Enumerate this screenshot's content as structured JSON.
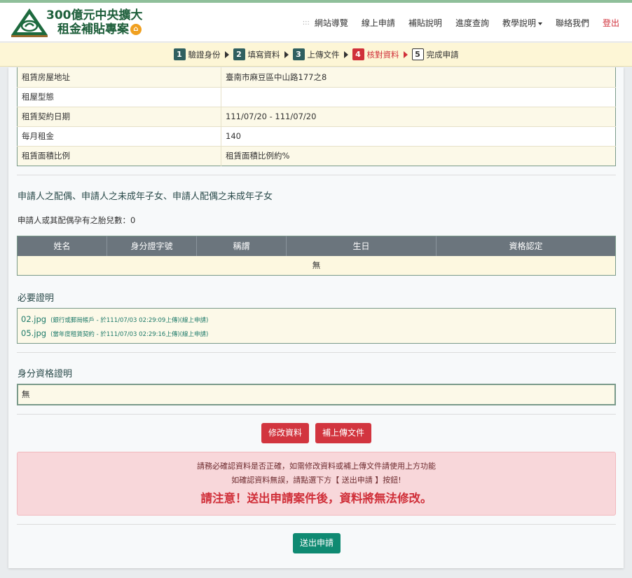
{
  "header": {
    "logo_line1": "300億元中央擴大",
    "logo_line2": "租金補貼專案",
    "nav": {
      "site_map": "網站導覽",
      "apply_online": "線上申請",
      "subsidy_info": "補貼說明",
      "progress": "進度查詢",
      "tutorial": "教學說明",
      "contact": "聯絡我們",
      "logout": "登出"
    }
  },
  "steps": [
    {
      "num": "1",
      "label": "驗證身份"
    },
    {
      "num": "2",
      "label": "填寫資料"
    },
    {
      "num": "3",
      "label": "上傳文件"
    },
    {
      "num": "4",
      "label": "核對資料"
    },
    {
      "num": "5",
      "label": "完成申請"
    }
  ],
  "rental_info": [
    {
      "label": "租賃房屋地址",
      "value": "臺南市麻豆區中山路177之8"
    },
    {
      "label": "租屋型態",
      "value": ""
    },
    {
      "label": "租賃契約日期",
      "value": "111/07/20 - 111/07/20"
    },
    {
      "label": "每月租金",
      "value": "140"
    },
    {
      "label": "租賃面積比例",
      "value": "租賃面積比例約%"
    }
  ],
  "family": {
    "title": "申請人之配偶、申請人之未成年子女、申請人配偶之未成年子女",
    "pregnancy_text": "申請人或其配偶孕有之胎兒數：0",
    "columns": [
      "姓名",
      "身分證字號",
      "稱謂",
      "生日",
      "資格認定"
    ],
    "empty_text": "無"
  },
  "required_docs": {
    "title": "必要證明",
    "files": [
      {
        "name": "02.jpg",
        "note": "(銀行或郵局帳戶 - 於111/07/03 02:29:09上傳)(線上申請)"
      },
      {
        "name": "05.jpg",
        "note": "(當年度租賃契約 - 於111/07/03 02:29:16上傳)(線上申請)"
      }
    ]
  },
  "identity_docs": {
    "title": "身分資格證明",
    "value": "無"
  },
  "buttons": {
    "edit": "修改資料",
    "upload_more": "補上傳文件",
    "submit": "送出申請"
  },
  "notice": {
    "line1": "請務必確認資料是否正確，如需修改資料或補上傳文件請使用上方功能",
    "line2": "如確認資料無誤，請點選下方【 送出申請 】按鈕!",
    "warning": "請注意！送出申請案件後，資料將無法修改。"
  },
  "colors": {
    "accent_red": "#d2353f",
    "accent_teal": "#0f8a72",
    "header_green": "#1d5e3a"
  }
}
